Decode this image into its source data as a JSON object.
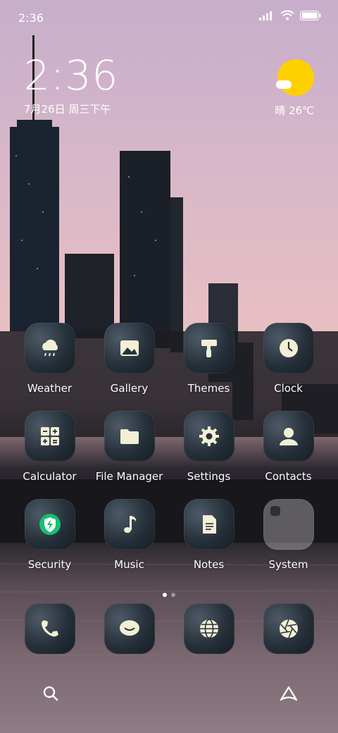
{
  "status_bar": {
    "time": "2:36"
  },
  "clock_widget": {
    "time": "2:36",
    "date": "7月26日 周三下午"
  },
  "weather_widget": {
    "text": "晴 26℃"
  },
  "apps": [
    {
      "label": "Weather",
      "icon": "weather-icon"
    },
    {
      "label": "Gallery",
      "icon": "gallery-icon"
    },
    {
      "label": "Themes",
      "icon": "themes-icon"
    },
    {
      "label": "Clock",
      "icon": "clock-icon"
    },
    {
      "label": "Calculator",
      "icon": "calculator-icon"
    },
    {
      "label": "File Manager",
      "icon": "folder-icon"
    },
    {
      "label": "Settings",
      "icon": "gear-icon"
    },
    {
      "label": "Contacts",
      "icon": "contact-icon"
    },
    {
      "label": "Security",
      "icon": "security-icon"
    },
    {
      "label": "Music",
      "icon": "music-icon"
    },
    {
      "label": "Notes",
      "icon": "notes-icon"
    },
    {
      "label": "System",
      "icon": "folder-system-icon"
    }
  ],
  "dock": [
    {
      "icon": "phone-icon"
    },
    {
      "icon": "messages-icon"
    },
    {
      "icon": "browser-icon"
    },
    {
      "icon": "camera-icon"
    }
  ],
  "page_indicator": {
    "pages": 2,
    "current": 1
  },
  "colors": {
    "accent_sun": "#ffd000",
    "security_green": "#14c06e",
    "icon_glyph": "#f2efd6"
  }
}
